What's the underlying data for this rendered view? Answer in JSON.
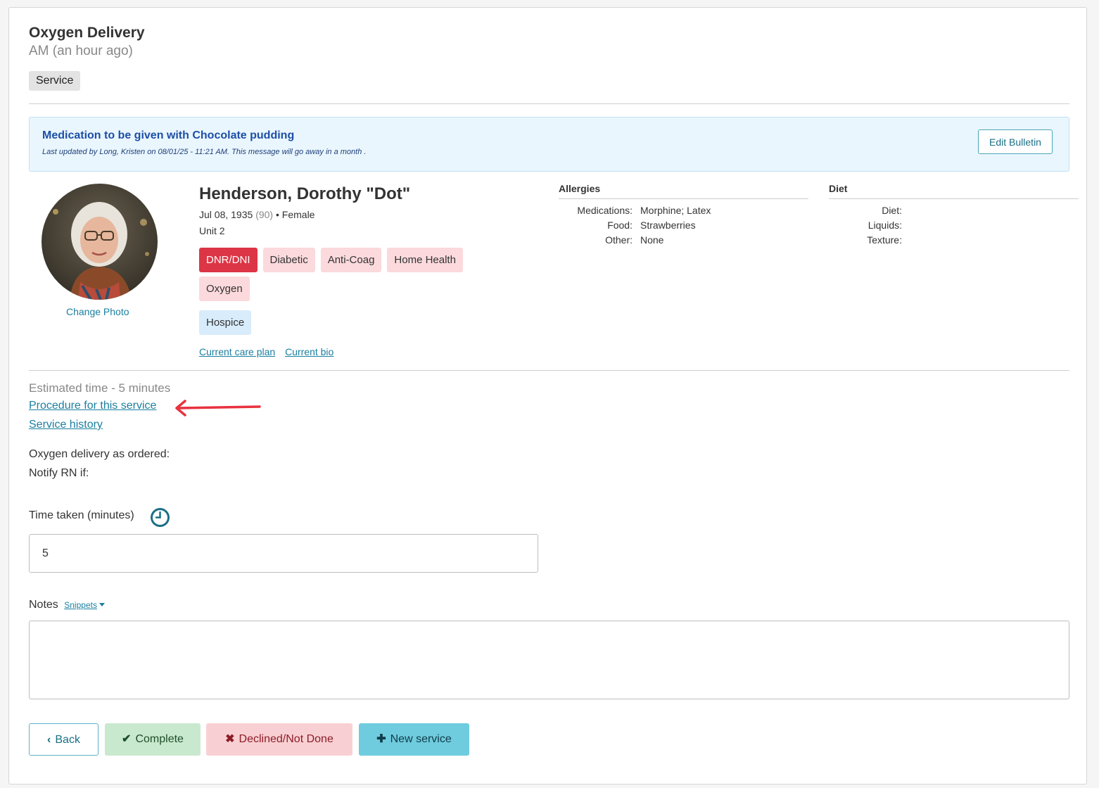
{
  "header": {
    "title": "Oxygen Delivery",
    "subtitle": "AM (an hour ago)",
    "type_badge": "Service"
  },
  "bulletin": {
    "title": "Medication to be given with Chocolate pudding",
    "meta": "Last updated by Long, Kristen on 08/01/25 - 11:21 AM. This message will go away in a month .",
    "edit_label": "Edit Bulletin"
  },
  "resident": {
    "change_photo": "Change Photo",
    "name": "Henderson, Dorothy \"Dot\"",
    "dob": "Jul 08, 1935",
    "age": "(90)",
    "gender_sep": "•",
    "gender": "Female",
    "unit": "Unit 2",
    "tags": [
      "DNR/DNI",
      "Diabetic",
      "Anti-Coag",
      "Home Health",
      "Oxygen"
    ],
    "hospice_tag": "Hospice",
    "links": {
      "care_plan": "Current care plan",
      "bio": "Current bio"
    }
  },
  "allergies": {
    "title": "Allergies",
    "rows": [
      {
        "k": "Medications:",
        "v": "Morphine; Latex"
      },
      {
        "k": "Food:",
        "v": "Strawberries"
      },
      {
        "k": "Other:",
        "v": "None"
      }
    ]
  },
  "diet": {
    "title": "Diet",
    "rows": [
      {
        "k": "Diet:",
        "v": ""
      },
      {
        "k": "Liquids:",
        "v": ""
      },
      {
        "k": "Texture:",
        "v": ""
      }
    ]
  },
  "service": {
    "estimated": "Estimated time - 5 minutes",
    "procedure_link": "Procedure for this service",
    "history_link": "Service history",
    "instruction_1": "Oxygen delivery as ordered:",
    "instruction_2": "Notify RN if:"
  },
  "form": {
    "time_label": "Time taken (minutes)",
    "time_value": "5",
    "notes_label": "Notes",
    "snippets_label": "Snippets",
    "notes_value": ""
  },
  "actions": {
    "back": "Back",
    "complete": "Complete",
    "declined": "Declined/Not Done",
    "new_service": "New service"
  },
  "colors": {
    "accent": "#1a7fa0",
    "dnr": "#dc3545",
    "arrow": "#e8323f"
  }
}
